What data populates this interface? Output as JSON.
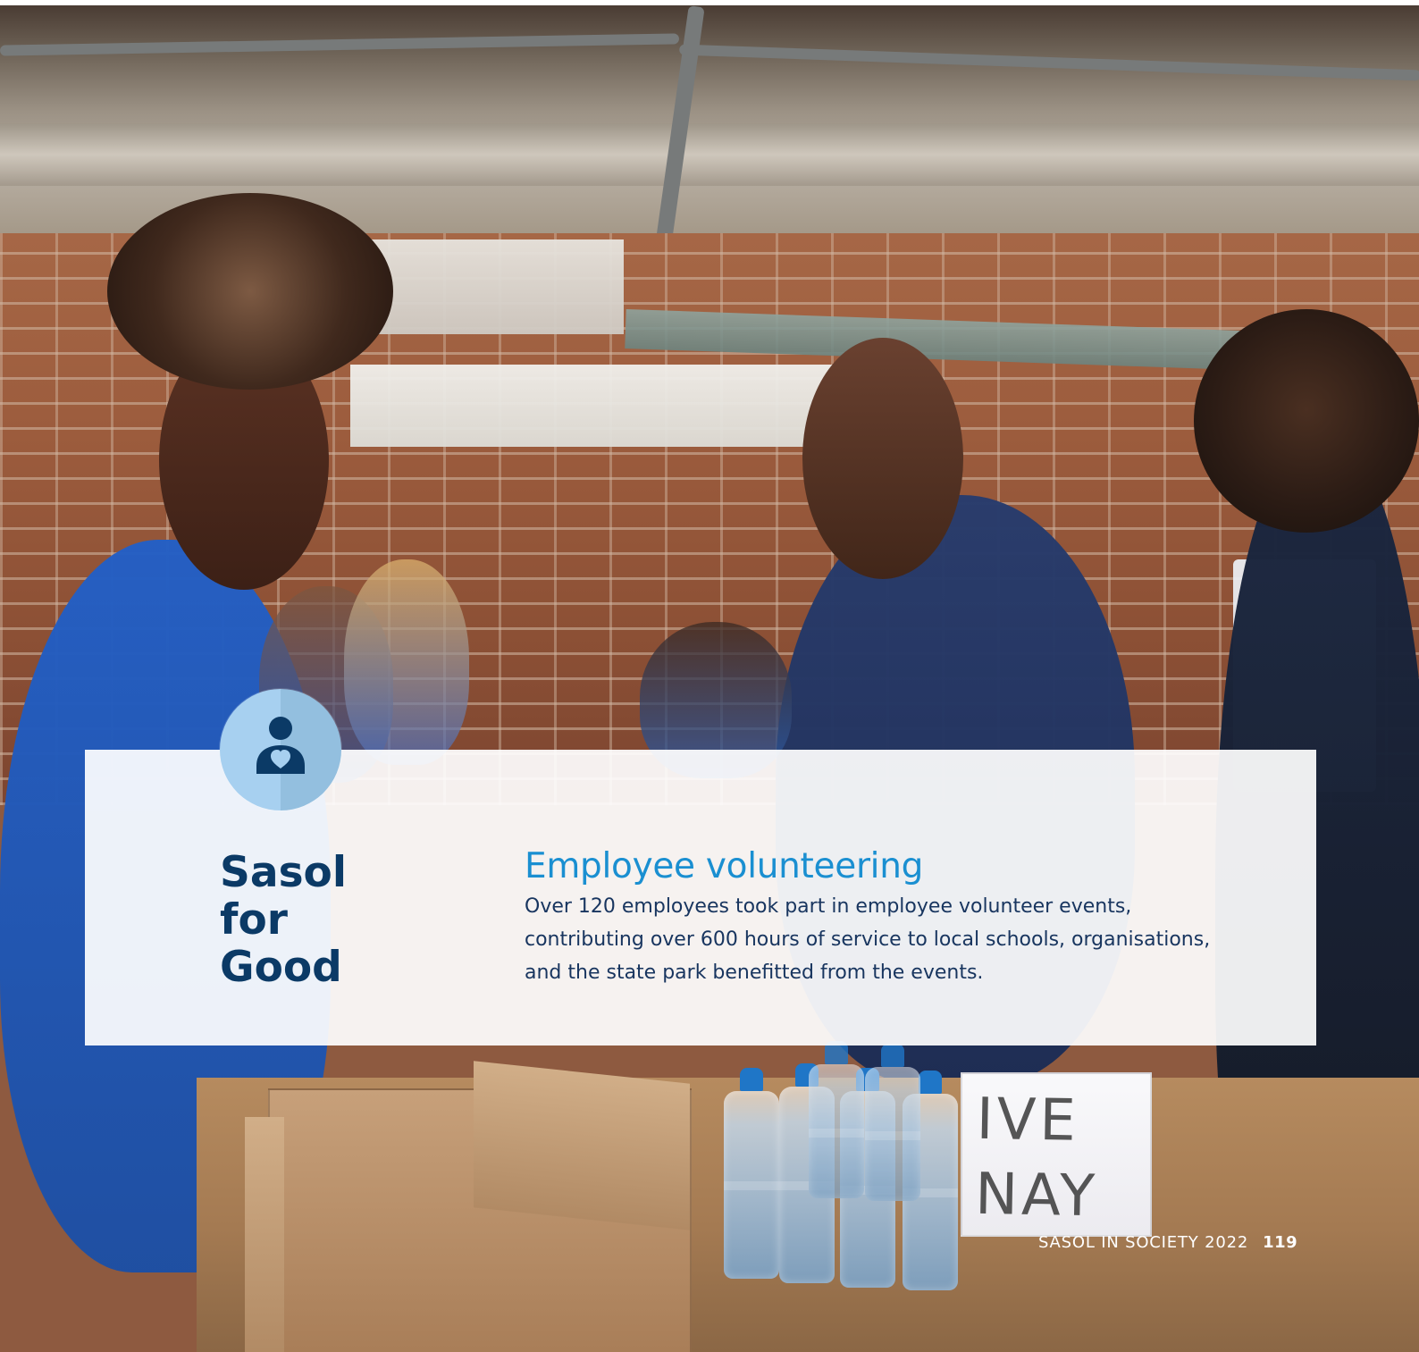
{
  "title": {
    "left": "Sasol\nfor\nGood"
  },
  "section": {
    "heading": "Employee volunteering",
    "body": "Over 120 employees took part in employee volunteer events, contributing over 600 hours of service to local schools, organisations, and the state park benefitted from the events."
  },
  "footer": {
    "label": "SASOL IN SOCIETY 2022",
    "page_number": "119"
  },
  "icons": {
    "badge": "person-heart-icon"
  },
  "colors": {
    "title_navy": "#0b3a66",
    "heading_blue": "#1a8fd1",
    "badge_light": "#a7d0f0",
    "badge_dark": "#93bfdf",
    "icon_dark": "#0b3a66"
  }
}
